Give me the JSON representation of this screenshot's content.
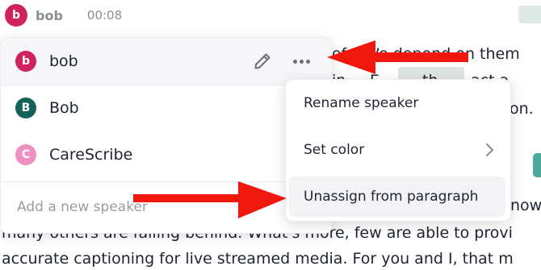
{
  "header": {
    "avatar_letter": "b",
    "name": "bob",
    "timestamp": "00:08"
  },
  "transcript_fragments": {
    "line1": "ofs. We depend on them",
    "line2a": "in",
    "line2b": "E",
    "line2c": "th",
    "line2d": "act a",
    "line3": "on.",
    "line5": "now",
    "line6": "many others are falling behind. What's more, few are able to provi",
    "line7": "accurate captioning for live streamed media. For you and I, that m"
  },
  "speaker_panel": {
    "speakers": [
      {
        "letter": "b",
        "name": "bob",
        "color": "#d0225e"
      },
      {
        "letter": "B",
        "name": "Bob",
        "color": "#14635a"
      },
      {
        "letter": "C",
        "name": "CareScribe",
        "color": "#f090c0"
      }
    ],
    "add_placeholder": "Add a new speaker"
  },
  "context_menu": {
    "rename_label": "Rename speaker",
    "set_color_label": "Set color",
    "unassign_label": "Unassign from paragraph"
  },
  "colors": {
    "accent_red_arrow": "#f0180c",
    "panel_border": "#ececef",
    "highlight": "#dfe5e2",
    "teal": "#4caa99"
  },
  "icons": {
    "edit": "pencil-icon",
    "more": "more-dots-icon",
    "submenu": "chevron-right-icon"
  }
}
